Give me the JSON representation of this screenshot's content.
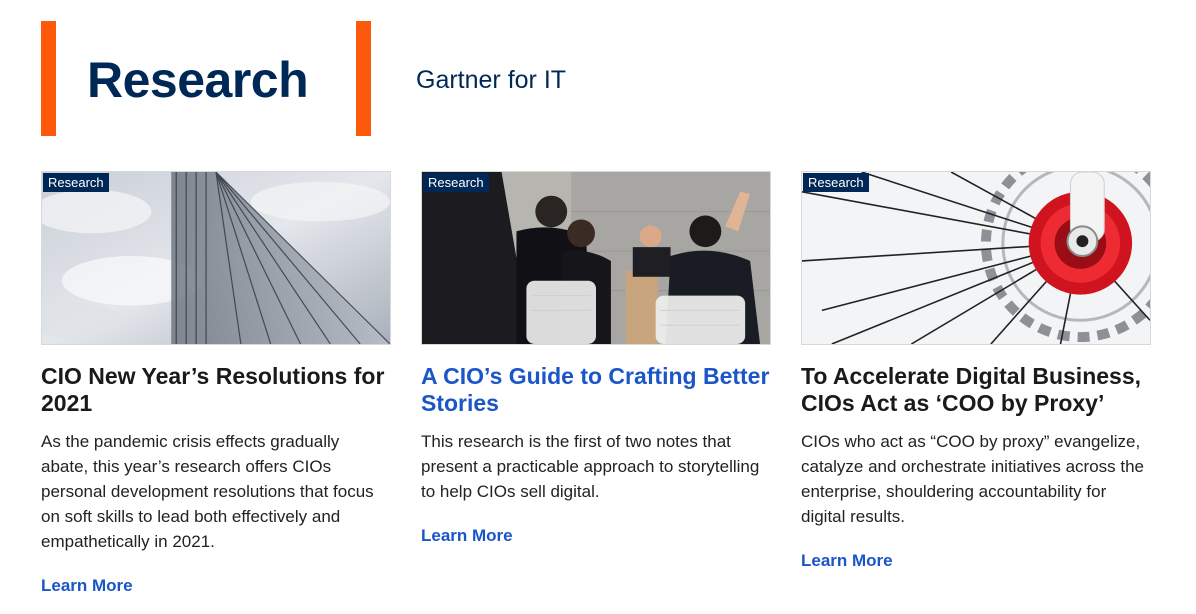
{
  "header": {
    "title": "Research",
    "subtitle": "Gartner for IT",
    "accent_color": "#fc5a0a",
    "title_color": "#002856"
  },
  "cards": [
    {
      "badge": "Research",
      "image": "glass-skyscraper-clouds",
      "title": "CIO New Year’s Resolutions for 2021",
      "description": "As the pandemic crisis effects gradually abate, this year’s research offers CIOs personal development resolutions that focus on soft skills to lead both effectively and empathetically in 2021.",
      "link_label": "Learn More"
    },
    {
      "badge": "Research",
      "image": "presenter-audience",
      "title": "A CIO’s Guide to Crafting Better Stories",
      "description": "This research is the first of two notes that present a practicable approach to storytelling to help CIOs sell digital.",
      "link_label": "Learn More"
    },
    {
      "badge": "Research",
      "image": "bicycle-wheel-hub",
      "title": "To Accelerate Digital Business, CIOs Act as ‘COO by Proxy’",
      "description": "CIOs who act as “COO by proxy” evangelize, catalyze and orchestrate initiatives across the enterprise, shouldering accountability for digital results.",
      "link_label": "Learn More"
    }
  ],
  "colors": {
    "badge_bg": "#002856",
    "link": "#1a56c8"
  }
}
